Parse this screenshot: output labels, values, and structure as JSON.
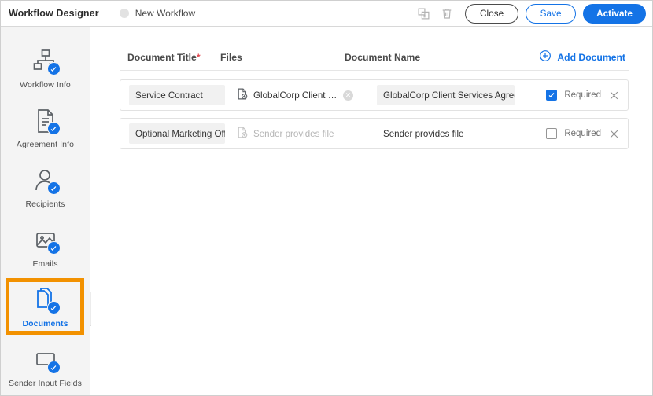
{
  "topbar": {
    "app_title": "Workflow Designer",
    "workflow_name": "New Workflow",
    "status_dot_color": "#e2e2e2",
    "copy_icon": "copy-icon",
    "delete_icon": "trash-icon",
    "close_label": "Close",
    "save_label": "Save",
    "activate_label": "Activate",
    "accent_color": "#1473e6"
  },
  "sidebar": {
    "highlight_color": "#f29100",
    "collapse_icon": "chevron-left-icon",
    "items": [
      {
        "label": "Workflow Info",
        "icon": "workflow-info-icon",
        "active": false
      },
      {
        "label": "Agreement Info",
        "icon": "agreement-info-icon",
        "active": false
      },
      {
        "label": "Recipients",
        "icon": "recipients-icon",
        "active": false
      },
      {
        "label": "Emails",
        "icon": "emails-icon",
        "active": false
      },
      {
        "label": "Documents",
        "icon": "documents-icon",
        "active": true
      },
      {
        "label": "Sender Input Fields",
        "icon": "sender-input-fields-icon",
        "active": false
      }
    ]
  },
  "documents": {
    "headers": {
      "title": "Document Title",
      "title_required_marker": "*",
      "files": "Files",
      "document_name": "Document Name"
    },
    "add_document_label": "Add Document",
    "add_document_icon": "plus-circle-icon",
    "required_label": "Required",
    "rows": [
      {
        "title": "Service Contract",
        "file_name": "GlobalCorp Client Servic...",
        "file_placeholder": "Sender provides file",
        "has_file": true,
        "document_name": "GlobalCorp Client Services Agreement",
        "document_name_placeholder": "Sender provides file",
        "required": true
      },
      {
        "title": "Optional Marketing Offer",
        "file_name": "",
        "file_placeholder": "Sender provides file",
        "has_file": false,
        "document_name": "",
        "document_name_placeholder": "Sender provides file",
        "required": false
      }
    ]
  }
}
